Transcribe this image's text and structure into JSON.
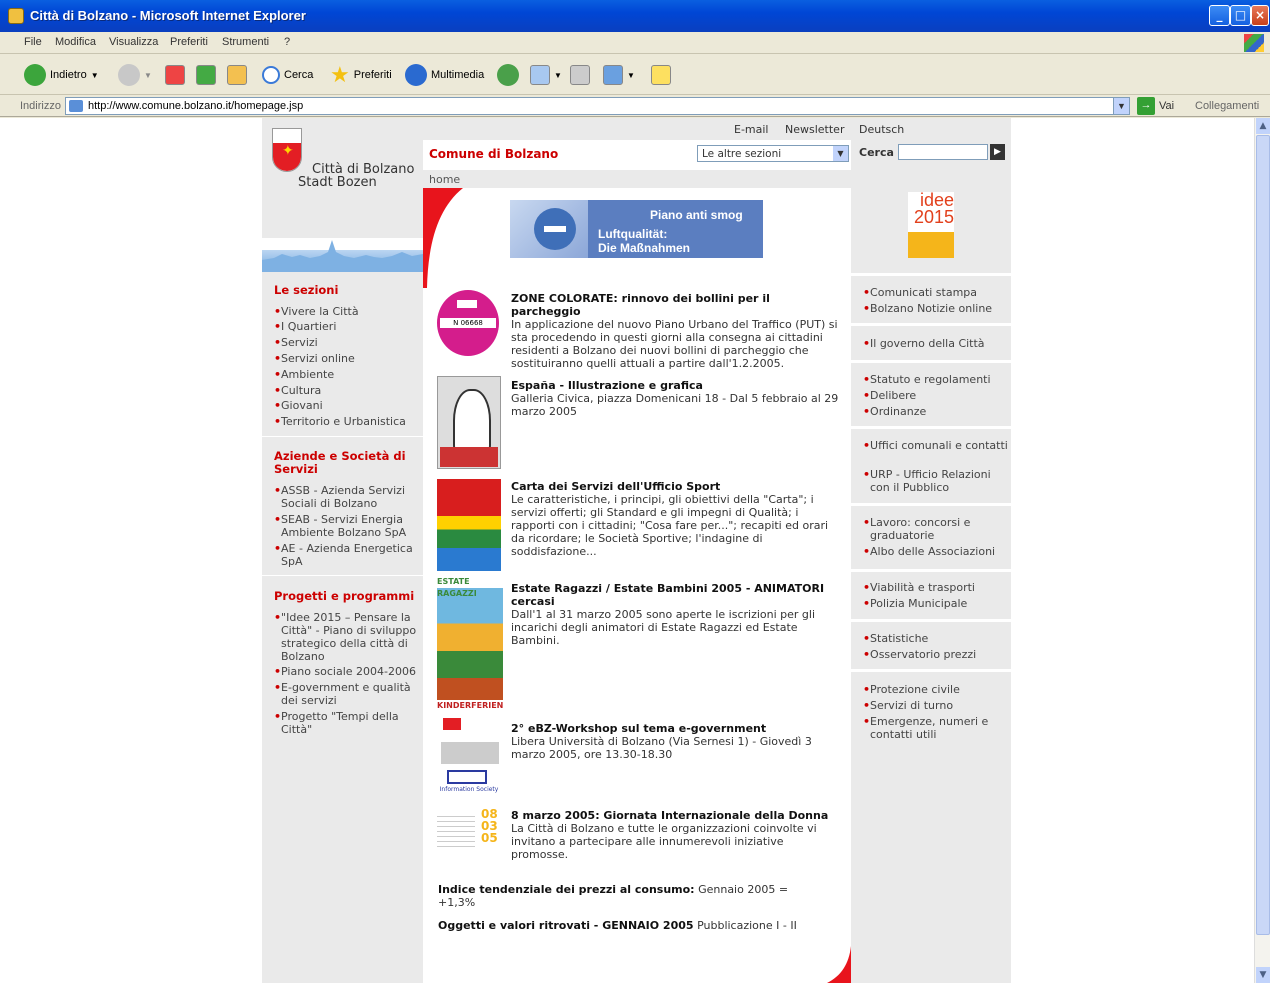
{
  "window": {
    "title": "Città di Bolzano - Microsoft Internet Explorer"
  },
  "menu": [
    "File",
    "Modifica",
    "Visualizza",
    "Preferiti",
    "Strumenti",
    "?"
  ],
  "toolbar": {
    "back": "Indietro",
    "search": "Cerca",
    "favorites": "Preferiti",
    "media": "Multimedia"
  },
  "address": {
    "label": "Indirizzo",
    "url": "http://www.comune.bolzano.it/homepage.jsp",
    "go": "Vai",
    "links": "Collegamenti"
  },
  "header": {
    "email": "E-mail",
    "newsletter": "Newsletter",
    "deutsch": "Deutsch",
    "site_title": "Comune di Bolzano",
    "select_value": "Le altre sezioni",
    "search_label": "Cerca",
    "breadcrumb": "home"
  },
  "logo": {
    "line1": "Città di Bolzano",
    "line2": "Stadt Bozen"
  },
  "banner": {
    "title": "Piano anti smog",
    "subtitle1": "Luftqualität:",
    "subtitle2": "Die Maßnahmen"
  },
  "idee_logo": {
    "top": "idee",
    "bottom": "2015"
  },
  "left": {
    "sezioni_title": "Le sezioni",
    "sezioni": [
      "Vivere la Città",
      "I Quartieri",
      "Servizi",
      "Servizi online",
      "Ambiente",
      "Cultura",
      "Giovani",
      "Territorio e Urbanistica"
    ],
    "aziende_title": "Aziende e Società di Servizi",
    "aziende": [
      "ASSB - Azienda Servizi Sociali di Bolzano",
      "SEAB - Servizi Energia Ambiente Bolzano SpA",
      "AE - Azienda Energetica SpA"
    ],
    "progetti_title": "Progetti e programmi",
    "progetti": [
      "\"Idee 2015 – Pensare la Città\" - Piano di sviluppo strategico della città di Bolzano",
      "Piano sociale 2004-2006",
      "E-government e qualità dei servizi",
      "Progetto \"Tempi della Città\""
    ]
  },
  "news": [
    {
      "title": "ZONE COLORATE: rinnovo dei bollini per il parcheggio",
      "body": "In applicazione del nuovo Piano Urbano del Traffico (PUT) si sta procedendo in questi giorni alla consegna ai cittadini residenti a Bolzano dei nuovi bollini di parcheggio che sostituiranno quelli attuali a partire dall'1.2.2005.",
      "img_label": "N 06668"
    },
    {
      "title": "España - Illustrazione e grafica",
      "body": "Galleria Civica, piazza Domenicani 18 - Dal 5 febbraio al 29 marzo 2005"
    },
    {
      "title": "Carta dei Servizi dell'Ufficio Sport",
      "body": "Le caratteristiche, i principi, gli obiettivi della \"Carta\"; i servizi offerti; gli Standard e gli impegni di Qualità; i rapporti con i cittadini; \"Cosa fare per...\"; recapiti ed orari da ricordare; le Società Sportive; l'indagine di soddisfazione..."
    },
    {
      "title": "Estate Ragazzi / Estate Bambini 2005 - ANIMATORI cercasi",
      "body": "Dall'1 al 31 marzo 2005 sono aperte le iscrizioni per gli incarichi degli animatori di Estate Ragazzi ed Estate Bambini.",
      "img_top": "ESTATE RAGAZZI",
      "img_bottom": "KINDERFERIEN"
    },
    {
      "title": "2° eBZ-Workshop sul tema e-government",
      "body": "Libera Università di Bolzano (Via Sernesi 1) - Giovedì 3 marzo 2005, ore 13.30-18.30",
      "img_label": "Information Society"
    },
    {
      "title": "8 marzo 2005: Giornata Internazionale della Donna",
      "body": "La Città di Bolzano e tutte le organizzazioni coinvolte vi invitano a partecipare alle innumerevoli iniziative promosse.",
      "img_nums": [
        "08",
        "03",
        "05"
      ]
    }
  ],
  "extra": {
    "indice_bold": "Indice tendenziale dei prezzi al consumo:",
    "indice_text": "Gennaio 2005 = +1,3%",
    "oggetti_bold": "Oggetti e valori ritrovati - GENNAIO 2005",
    "oggetti_text": "Pubblicazione I - II"
  },
  "right": [
    [
      "Comunicati stampa",
      "Bolzano Notizie online"
    ],
    [
      "Il governo della Città"
    ],
    [
      "Statuto e regolamenti",
      "Delibere",
      "Ordinanze"
    ],
    [
      "Uffici comunali e contatti",
      "URP - Ufficio Relazioni con il Pubblico"
    ],
    [
      "Lavoro: concorsi e graduatorie",
      "Albo delle Associazioni"
    ],
    [
      "Viabilità e trasporti",
      "Polizia Municipale"
    ],
    [
      "Statistiche",
      "Osservatorio prezzi"
    ],
    [
      "Protezione civile",
      "Servizi di turno",
      "Emergenze, numeri e contatti utili"
    ]
  ]
}
